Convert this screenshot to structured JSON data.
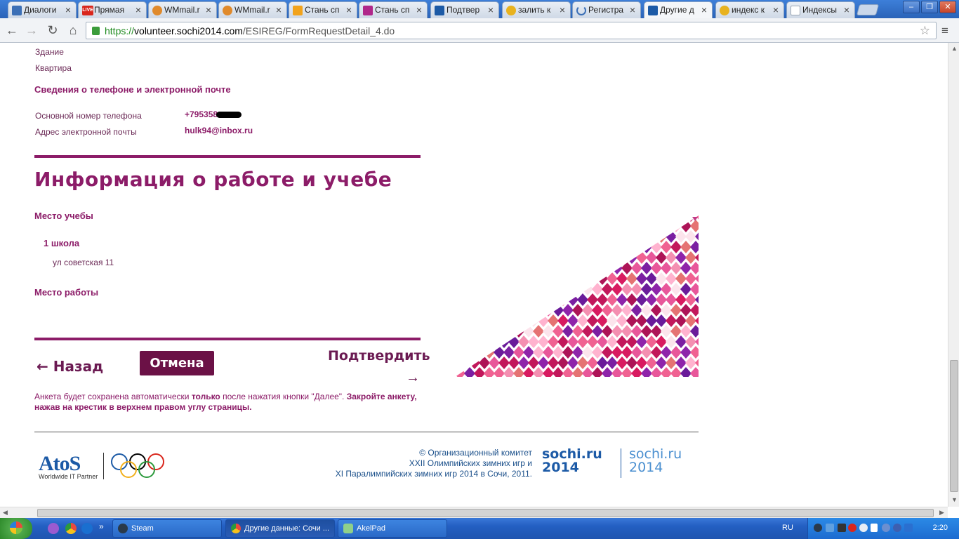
{
  "browser": {
    "tabs": [
      {
        "label": "Диалоги",
        "icon": "dialog-icon",
        "color": "#3b6fb6"
      },
      {
        "label": "Прямая",
        "icon": "live-icon",
        "color": "#d9261c"
      },
      {
        "label": "WMmail.r",
        "icon": "wmmail-icon",
        "color": "#e08a2c"
      },
      {
        "label": "WMmail.r",
        "icon": "wmmail-icon",
        "color": "#e08a2c"
      },
      {
        "label": "Стань сп",
        "icon": "sochi-folder-icon",
        "color": "#f2a31c"
      },
      {
        "label": "Стань сп",
        "icon": "sochi-logo-icon",
        "color": "#b0278a"
      },
      {
        "label": "Подтвер",
        "icon": "atos-icon",
        "color": "#1c5aa6"
      },
      {
        "label": "залить к",
        "icon": "search-icon",
        "color": "#e8b21e"
      },
      {
        "label": "Регистра",
        "icon": "loading-icon",
        "color": "#3b6fb6"
      },
      {
        "label": "Другие д",
        "icon": "sochi-logo-icon",
        "color": "#1c5aa6"
      },
      {
        "label": "индекс к",
        "icon": "search-icon",
        "color": "#e8b21e"
      },
      {
        "label": "Индексы",
        "icon": "page-icon",
        "color": "#9aa5b3"
      }
    ],
    "url_scheme": "https://",
    "url_domain": "volunteer.sochi2014.com",
    "url_path": "/ESIREG/FormRequestDetail_4.do"
  },
  "contact": {
    "building_label": "Здание",
    "apartment_label": "Квартира",
    "section_title": "Сведения о телефоне и электронной почте",
    "phone_label": "Основной номер телефона",
    "phone_value": "+795358",
    "email_label": "Адрес электронной почты",
    "email_value": "hulk94@inbox.ru"
  },
  "work_study": {
    "title": "Информация о работе и учебе",
    "study_label": "Место учебы",
    "school_name": "1 школа",
    "school_address": "ул советская 11",
    "work_label": "Место работы"
  },
  "actions": {
    "back": "← Назад",
    "cancel": "Отмена",
    "confirm": "Подтвердить",
    "confirm_arrow": "→"
  },
  "note": {
    "part1": "Анкета будет сохранена автоматически ",
    "part2": "только",
    "part3": " после нажатия кнопки \"Далее\". ",
    "part4": "Закройте анкету, нажав на крестик в верхнем правом углу страницы."
  },
  "footer": {
    "atos_logo": "AtoS",
    "atos_sub": "Worldwide IT Partner",
    "copyright_line1": "© Организационный комитет",
    "copyright_line2": "XXII Олимпийских зимних игр и",
    "copyright_line3": "XI Паралимпийских зимних игр 2014 в Сочи, 2011.",
    "sochi_logo_1a": "sochi.ru",
    "sochi_logo_1b": "2014",
    "sochi_logo_2a": "sochi.ru",
    "sochi_logo_2b": "2014"
  },
  "taskbar": {
    "items": [
      {
        "label": "Steam",
        "icon": "steam-icon"
      },
      {
        "label": "Другие данные: Сочи ...",
        "icon": "chrome-icon"
      },
      {
        "label": "AkelPad",
        "icon": "akelpad-icon"
      }
    ],
    "language": "RU",
    "clock": "2:20"
  },
  "colors": {
    "brand_purple": "#8c1c68",
    "cancel_bg": "#6b1146",
    "footer_blue": "#1c5aa6"
  }
}
